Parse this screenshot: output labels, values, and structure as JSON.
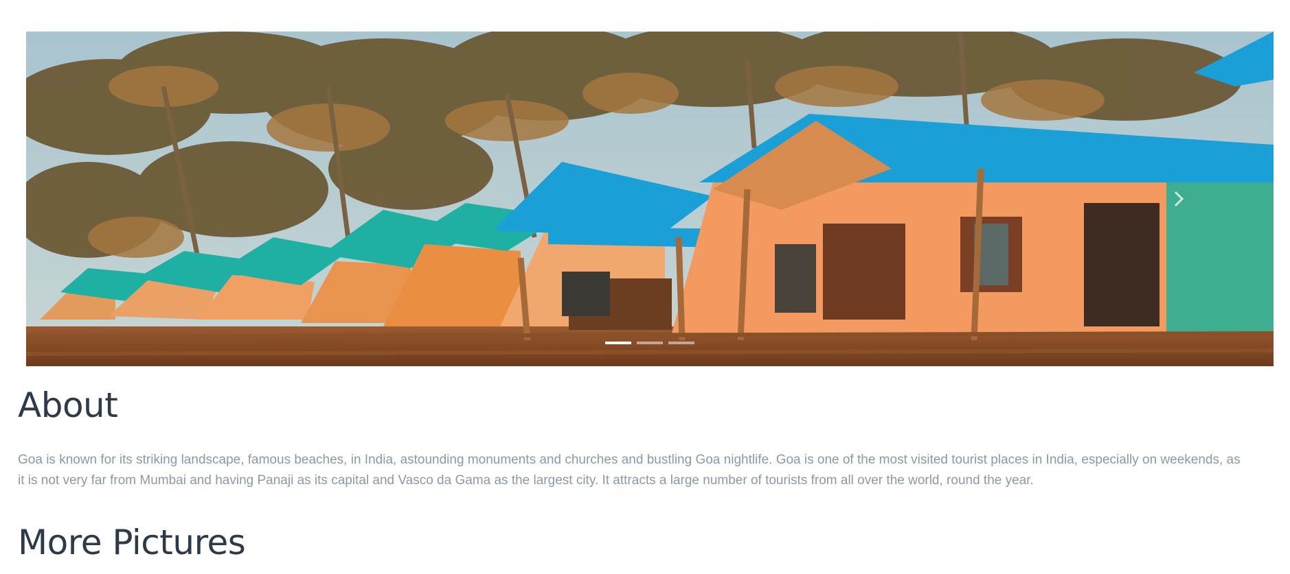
{
  "carousel": {
    "slide_count": 3,
    "active_index": 0,
    "image_subject": "beach-huts-under-palm-trees"
  },
  "about": {
    "title": "About",
    "text": "Goa is known for its striking landscape, famous beaches, in India, astounding monuments and churches and bustling Goa nightlife. Goa is one of the most visited tourist places in India, especially on weekends, as it is not very far from Mumbai and having Panaji as its capital and Vasco da Gama as the largest city. It attracts a large number of tourists from all over the world, round the year."
  },
  "more_pictures": {
    "title": "More Pictures"
  },
  "colors": {
    "heading": "#2d3a48",
    "body_text": "#8b99a6",
    "roof_blue": "#1a9fd6",
    "roof_teal": "#1fb0a4",
    "hut_orange": "#f0a062"
  }
}
